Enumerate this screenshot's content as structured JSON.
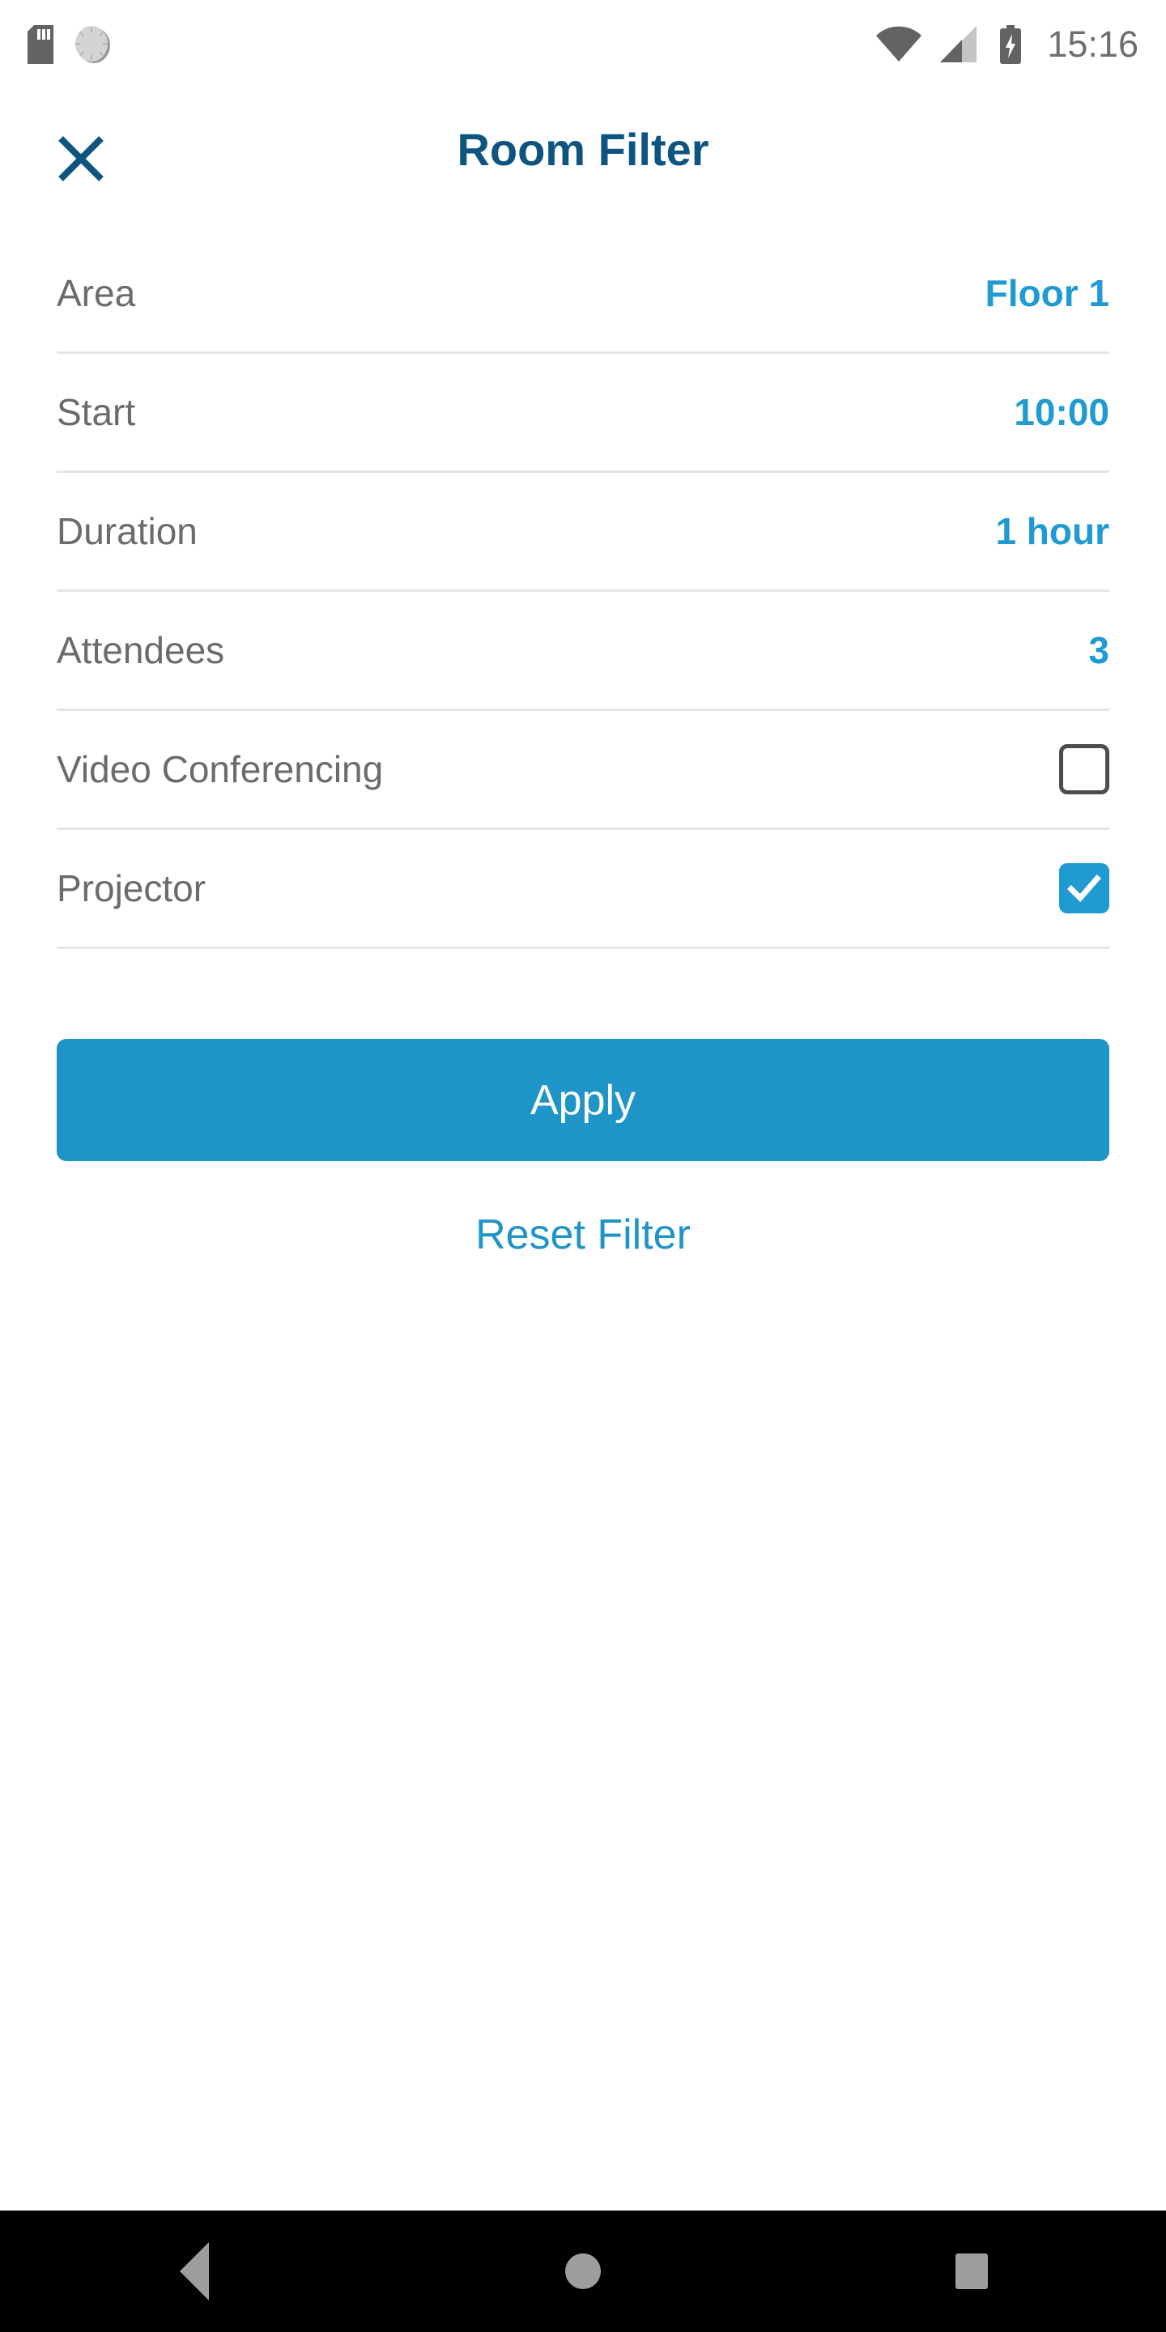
{
  "status_bar": {
    "time": "15:16",
    "left_icons": [
      "sd-card-icon",
      "clock-icon"
    ],
    "right_icons": [
      "wifi-icon",
      "cellular-signal-icon",
      "battery-charging-icon"
    ]
  },
  "header": {
    "close_icon": "close-icon",
    "title": "Room Filter",
    "title_color": "#0d5580"
  },
  "filters": {
    "rows": [
      {
        "label": "Area",
        "value": "Floor 1",
        "type": "value"
      },
      {
        "label": "Start",
        "value": "10:00",
        "type": "value"
      },
      {
        "label": "Duration",
        "value": "1 hour",
        "type": "value"
      },
      {
        "label": "Attendees",
        "value": "3",
        "type": "value"
      },
      {
        "label": "Video Conferencing",
        "value": "",
        "type": "checkbox",
        "checked": false
      },
      {
        "label": "Projector",
        "value": "",
        "type": "checkbox",
        "checked": true
      }
    ]
  },
  "actions": {
    "apply_label": "Apply",
    "reset_label": "Reset Filter",
    "accent_color": "#1f94c6",
    "value_color": "#1f9bd1"
  },
  "nav_bar": {
    "back_label": "back-icon",
    "home_label": "home-icon",
    "recent_label": "recent-apps-icon"
  }
}
